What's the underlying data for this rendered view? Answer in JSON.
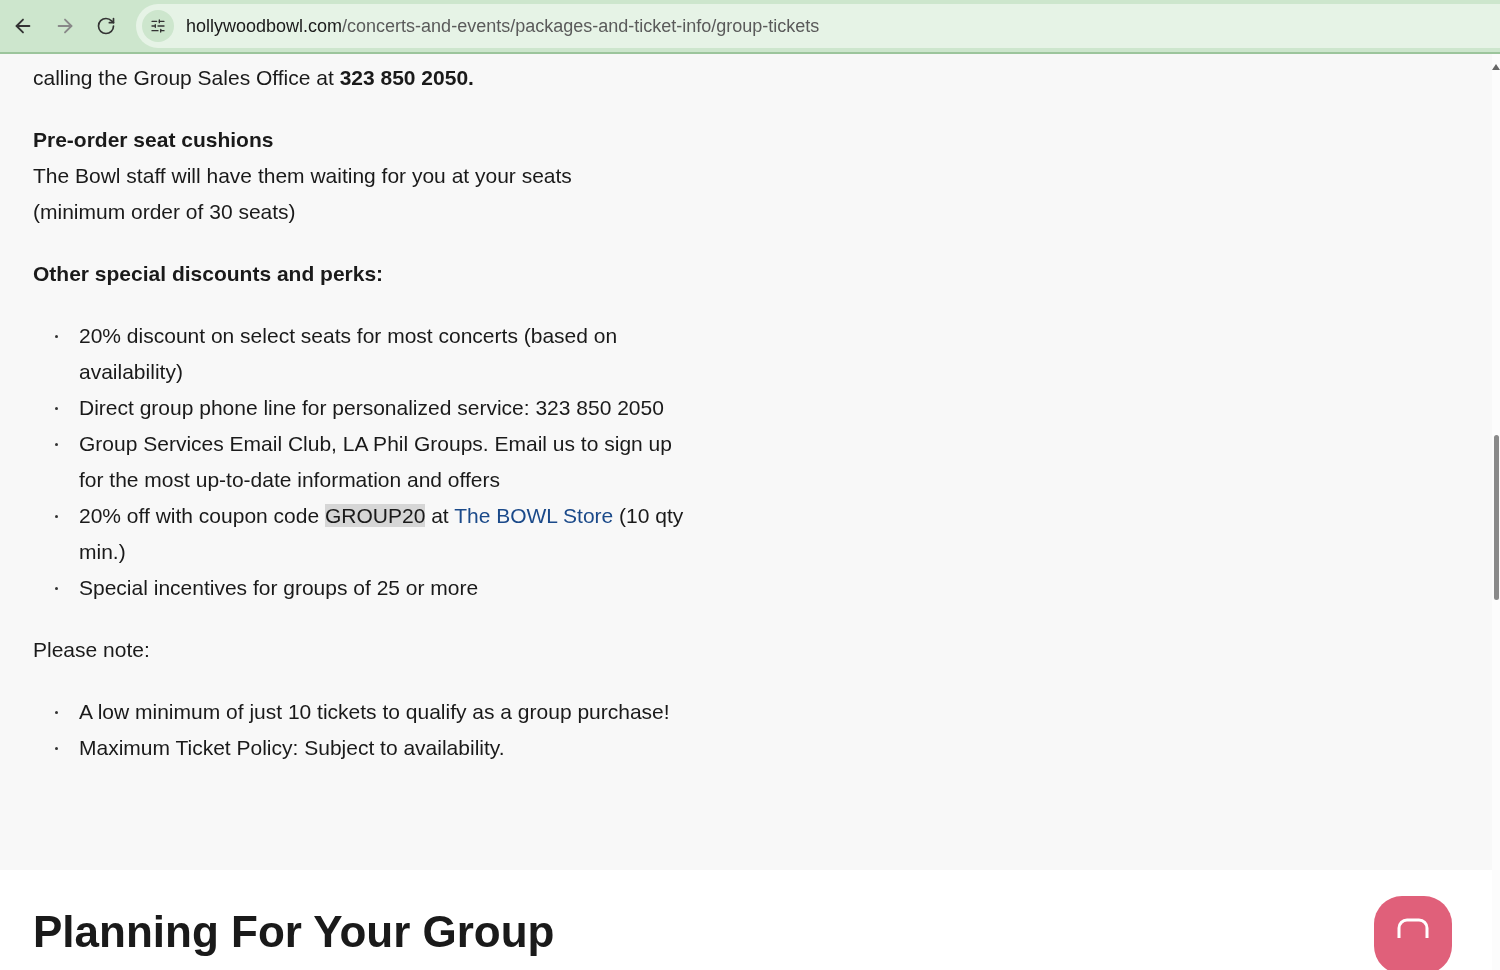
{
  "browser": {
    "url_domain": "hollywoodbowl.com",
    "url_path": "/concerts-and-events/packages-and-ticket-info/group-tickets"
  },
  "intro": "calling the Group Sales Office at **323 850 2050.**",
  "cushions": {
    "heading": "Pre-order seat cushions",
    "text": "The Bowl staff will have them waiting for you at your seats (minimum order of 30 seats)"
  },
  "perks": {
    "heading": "Other special discounts and perks:",
    "items": [
      {
        "text": "20% discount on select seats for most concerts (based on availability)"
      },
      {
        "text": "Direct group phone line for personalized service: 323 850 2050"
      },
      {
        "text": "Group Services Email Club, LA Phil Groups. Email us to sign up for the most up-to-date information and offers"
      },
      {
        "text": "20% off with coupon code ",
        "code": "GROUP20",
        "middle": " at ",
        "link": "The BOWL Store",
        "after": " (10 qty min.)"
      },
      {
        "text": "Special incentives for groups of 25 or more"
      }
    ]
  },
  "note": {
    "heading": "Please note:",
    "items": [
      {
        "text": "A low minimum of just 10 tickets to qualify as a group purchase!"
      },
      {
        "text": "Maximum Ticket Policy: Subject to availability."
      }
    ]
  },
  "next_section": {
    "heading": "Planning For Your Group"
  }
}
